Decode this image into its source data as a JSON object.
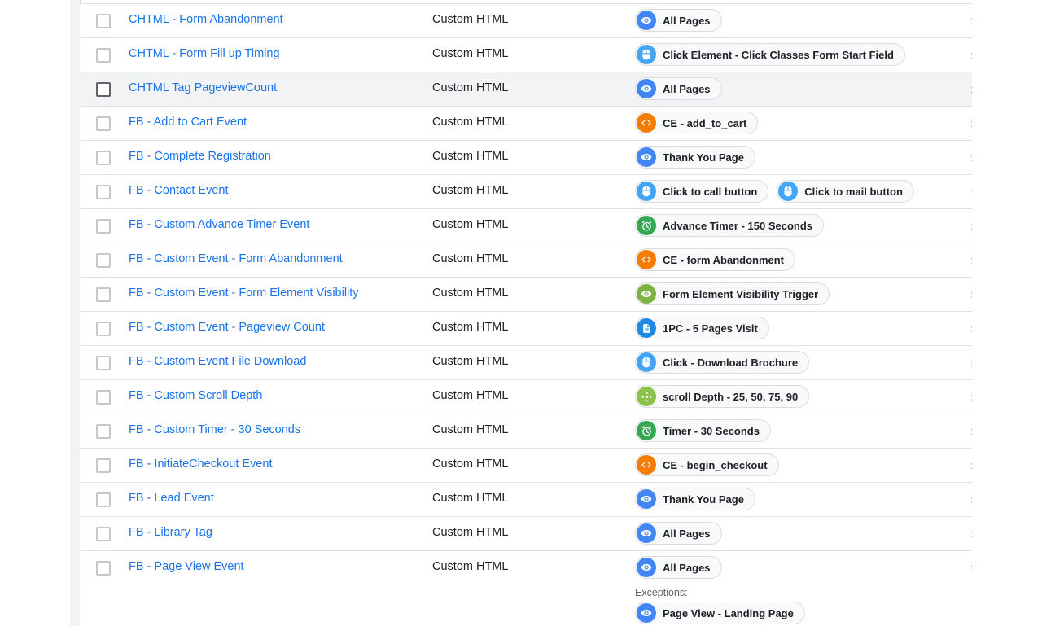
{
  "exceptions_label": "Exceptions:",
  "icon_colors": {
    "pageview": "#4285f4",
    "click": "#42a5f5",
    "custom": "#f57c00",
    "timer": "#34a853",
    "visibility": "#7cb342",
    "history": "#1e88e5",
    "scroll": "#8bc34a"
  },
  "tags": [
    {
      "name": "CHTML - Form Abandonment",
      "type": "Custom HTML",
      "triggers": [
        {
          "icon": "eye-icon",
          "kind": "pageview",
          "label": "All Pages"
        }
      ]
    },
    {
      "name": "CHTML - Form Fill up Timing",
      "type": "Custom HTML",
      "triggers": [
        {
          "icon": "mouse-icon",
          "kind": "click",
          "label": "Click Element - Click Classes Form Start Field"
        }
      ]
    },
    {
      "name": "CHTML Tag PageviewCount",
      "type": "Custom HTML",
      "triggers": [
        {
          "icon": "eye-icon",
          "kind": "pageview",
          "label": "All Pages"
        }
      ]
    },
    {
      "name": "FB - Add to Cart Event",
      "type": "Custom HTML",
      "triggers": [
        {
          "icon": "code-icon",
          "kind": "custom",
          "label": "CE - add_to_cart"
        }
      ]
    },
    {
      "name": "FB - Complete Registration",
      "type": "Custom HTML",
      "triggers": [
        {
          "icon": "eye-icon",
          "kind": "pageview",
          "label": "Thank You Page"
        }
      ]
    },
    {
      "name": "FB - Contact Event",
      "type": "Custom HTML",
      "triggers": [
        {
          "icon": "mouse-icon",
          "kind": "click",
          "label": "Click to call button"
        },
        {
          "icon": "mouse-icon",
          "kind": "click",
          "label": "Click to mail button"
        }
      ]
    },
    {
      "name": "FB - Custom Advance Timer Event",
      "type": "Custom HTML",
      "triggers": [
        {
          "icon": "timer-icon",
          "kind": "timer",
          "label": "Advance Timer - 150 Seconds"
        }
      ]
    },
    {
      "name": "FB - Custom Event - Form Abandonment",
      "type": "Custom HTML",
      "triggers": [
        {
          "icon": "code-icon",
          "kind": "custom",
          "label": "CE - form Abandonment"
        }
      ]
    },
    {
      "name": "FB - Custom Event - Form Element Visibility",
      "type": "Custom HTML",
      "triggers": [
        {
          "icon": "eye-icon",
          "kind": "visibility",
          "label": "Form Element Visibility Trigger"
        }
      ]
    },
    {
      "name": "FB - Custom Event - Pageview Count",
      "type": "Custom HTML",
      "triggers": [
        {
          "icon": "document-icon",
          "kind": "history",
          "label": "1PC - 5 Pages Visit"
        }
      ]
    },
    {
      "name": "FB - Custom Event File Download",
      "type": "Custom HTML",
      "triggers": [
        {
          "icon": "mouse-icon",
          "kind": "click",
          "label": "Click - Download Brochure"
        }
      ]
    },
    {
      "name": "FB - Custom Scroll Depth",
      "type": "Custom HTML",
      "triggers": [
        {
          "icon": "scroll-icon",
          "kind": "scroll",
          "label": "scroll Depth - 25, 50, 75, 90"
        }
      ]
    },
    {
      "name": "FB - Custom Timer - 30 Seconds",
      "type": "Custom HTML",
      "triggers": [
        {
          "icon": "timer-icon",
          "kind": "timer",
          "label": "Timer - 30 Seconds"
        }
      ]
    },
    {
      "name": "FB - InitiateCheckout Event",
      "type": "Custom HTML",
      "triggers": [
        {
          "icon": "code-icon",
          "kind": "custom",
          "label": "CE - begin_checkout"
        }
      ]
    },
    {
      "name": "FB - Lead Event",
      "type": "Custom HTML",
      "triggers": [
        {
          "icon": "eye-icon",
          "kind": "pageview",
          "label": "Thank You Page"
        }
      ]
    },
    {
      "name": "FB - Library Tag",
      "type": "Custom HTML",
      "triggers": [
        {
          "icon": "eye-icon",
          "kind": "pageview",
          "label": "All Pages"
        }
      ]
    },
    {
      "name": "FB - Page View Event",
      "type": "Custom HTML",
      "triggers": [
        {
          "icon": "eye-icon",
          "kind": "pageview",
          "label": "All Pages"
        }
      ],
      "exceptions": [
        {
          "icon": "eye-icon",
          "kind": "pageview",
          "label": "Page View - Landing Page"
        }
      ]
    }
  ]
}
